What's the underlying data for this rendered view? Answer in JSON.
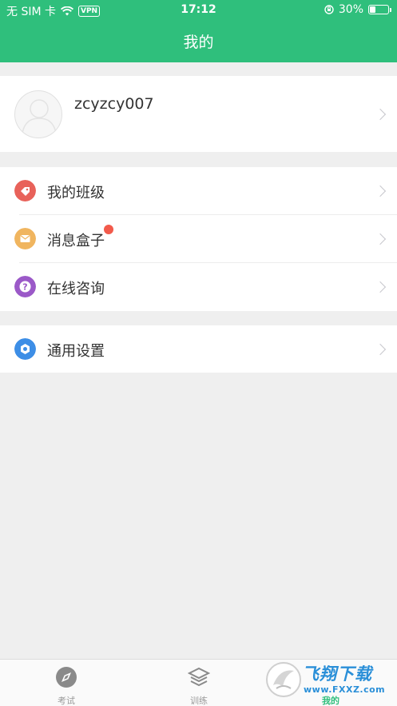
{
  "status_bar": {
    "carrier": "无 SIM 卡",
    "vpn": "VPN",
    "time": "17:12",
    "battery_text": "30%",
    "battery_level": 0.3
  },
  "header": {
    "title": "我的"
  },
  "profile": {
    "username": "zcyzcy007"
  },
  "menu": [
    {
      "label": "我的班级",
      "icon": "tag-icon",
      "color": "#e8625a"
    },
    {
      "label": "消息盒子",
      "icon": "mail-icon",
      "color": "#f0b55f",
      "has_badge": true
    },
    {
      "label": "在线咨询",
      "icon": "question-icon",
      "color": "#9b59c8"
    }
  ],
  "settings": {
    "label": "通用设置",
    "icon": "settings-icon",
    "color": "#3d8ee6"
  },
  "tabs": [
    {
      "label": "考试",
      "icon": "compass-icon"
    },
    {
      "label": "训练",
      "icon": "layers-icon"
    },
    {
      "label": "我的",
      "icon": "user-icon",
      "active": true
    }
  ],
  "watermark": {
    "brand": "飞翔下载",
    "url": "www.FXXZ.com"
  },
  "colors": {
    "accent": "#2fbf7c",
    "background": "#efefef"
  }
}
